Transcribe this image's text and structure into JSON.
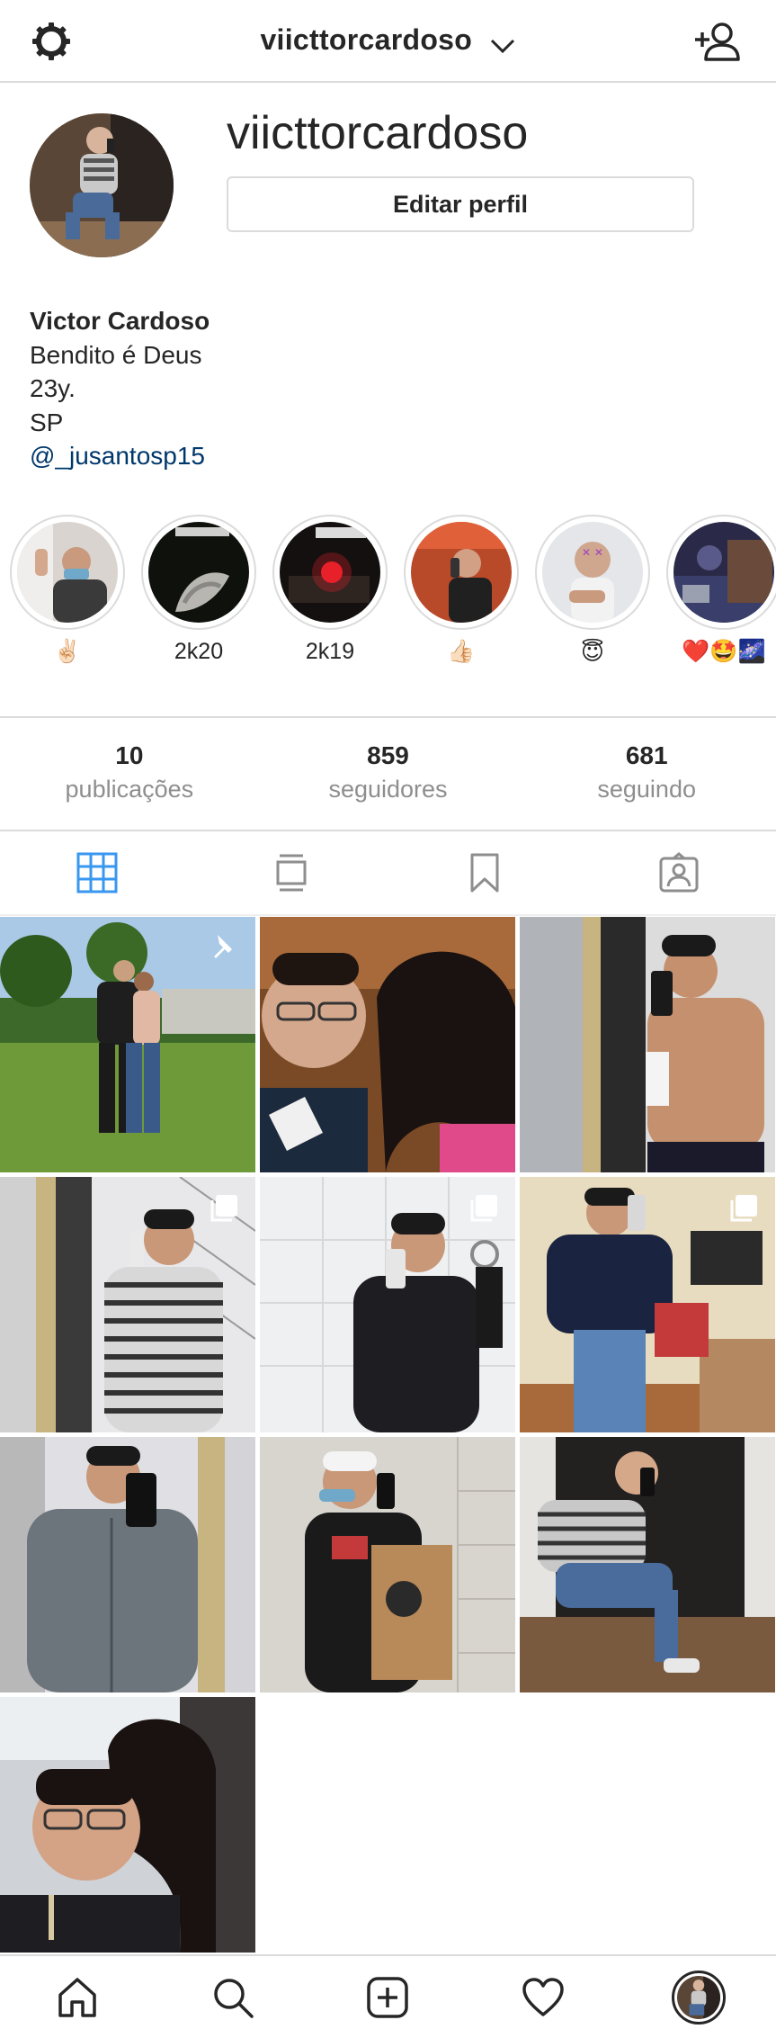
{
  "header": {
    "username": "viicttorcardoso"
  },
  "profile": {
    "username": "viicttorcardoso",
    "edit_label": "Editar perfil",
    "bio": {
      "name": "Victor Cardoso",
      "line1": "Bendito é Deus",
      "line2": "23y.",
      "line3": "SP",
      "mention": "@_jusantosp15"
    }
  },
  "highlights": [
    {
      "label": "✌🏻"
    },
    {
      "label": "2k20"
    },
    {
      "label": "2k19"
    },
    {
      "label": "👍🏻"
    },
    {
      "label": "😇"
    },
    {
      "label": "❤️🤩🌌"
    }
  ],
  "stats": {
    "posts": {
      "value": "10",
      "label": "publicações"
    },
    "followers": {
      "value": "859",
      "label": "seguidores"
    },
    "following": {
      "value": "681",
      "label": "seguindo"
    }
  },
  "tabs": [
    "grid-icon",
    "feed-icon",
    "saved-icon",
    "tagged-icon"
  ],
  "colors": {
    "accent": "#3897f0",
    "text": "#262626",
    "muted": "#8e8e8e",
    "border": "#dbdbdb",
    "link": "#00376b"
  },
  "posts_count_visible": 10,
  "bottom_nav": [
    "home-icon",
    "search-icon",
    "new-post-icon",
    "activity-icon",
    "profile-avatar"
  ]
}
